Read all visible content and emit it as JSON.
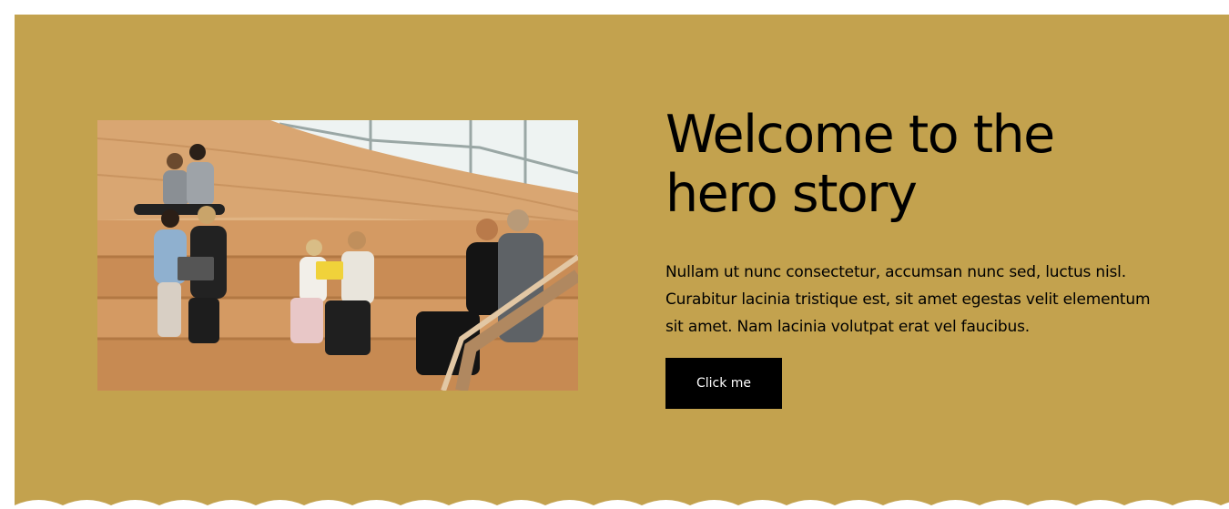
{
  "hero": {
    "title": "Welcome to the hero story",
    "body": "Nullam ut nunc consectetur, accumsan nunc sed, luctus nisl. Curabitur lacinia tristique est, sit amet egestas velit elementum sit amet. Nam lacinia volutpat erat vel faucibus.",
    "button_label": "Click me",
    "image_icon": "photo-people-on-wooden-stairs"
  },
  "colors": {
    "background": "#c3a24e",
    "button": "#000000",
    "button_text": "#ffffff",
    "text": "#000000",
    "page": "#ffffff"
  }
}
